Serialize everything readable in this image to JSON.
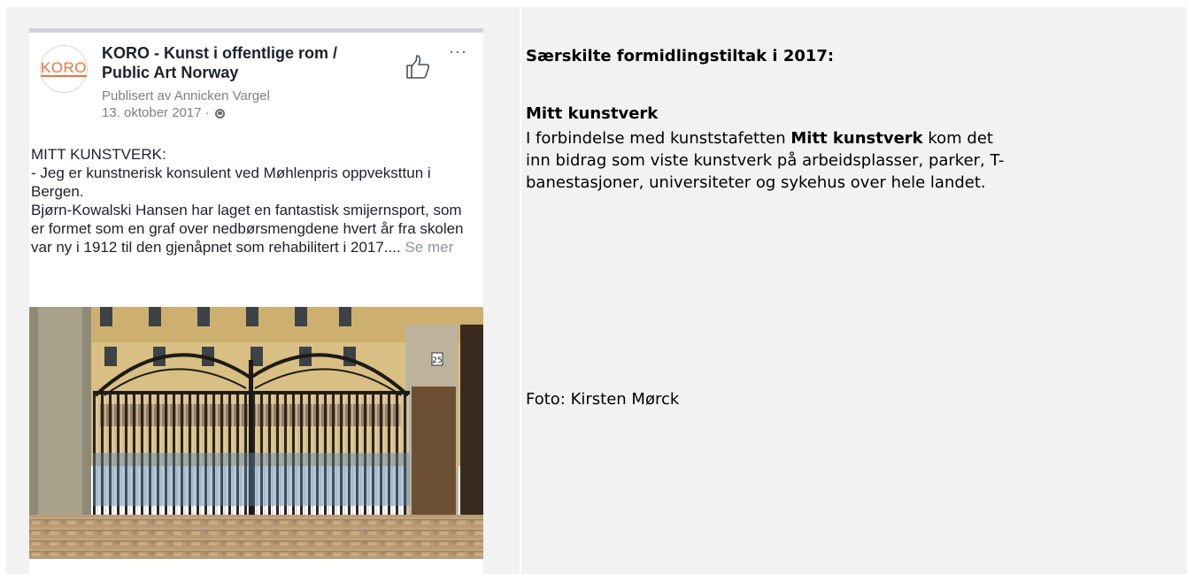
{
  "post": {
    "avatar_text": "KORO",
    "page_name": "KORO - Kunst i offentlige rom / Public Art Norway",
    "published_by": "Publisert av Annicken Vargel",
    "date": "13. oktober 2017 ·",
    "text_title": "MITT KUNSTVERK:",
    "text_line1": "- Jeg er kunstnerisk konsulent ved Møhlenpris oppveksttun i Bergen.",
    "text_line2": "Bjørn-Kowalski Hansen har laget en fantastisk smijernsport, som er formet som en graf over nedbørsmengdene hvert år fra skolen var ny i 1912 til den gjenåpnet som rehabilitert i 2017....",
    "see_more": "Se mer",
    "more_glyph": "···",
    "photo_sign": "25"
  },
  "right": {
    "heading": "Særskilte formidlingstiltak i 2017:",
    "sub_heading": "Mitt kunstverk",
    "body_prefix": "I forbindelse med kunststafetten ",
    "body_bold": "Mitt kunstverk",
    "body_suffix": " kom det inn bidrag som viste kunstverk på arbeidsplasser, parker, T-banestasjoner, universiteter og sykehus over hele landet.",
    "photo_credit": "Foto: Kirsten Mørck"
  },
  "icons": {
    "avatar": "koro-logo-icon",
    "like": "thumbs-up-icon",
    "more": "more-options-icon",
    "audience": "globe-icon"
  },
  "colors": {
    "brand_orange": "#e8743b",
    "cell_bg": "#f2f2f2",
    "meta_gray": "#7f7f7f",
    "see_more_gray": "#8d949e"
  }
}
